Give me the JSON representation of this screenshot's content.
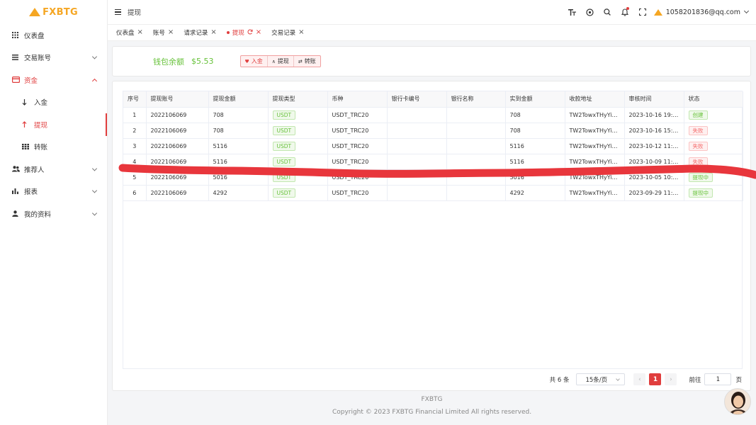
{
  "brand": {
    "logo_text": "FXBTG",
    "accent": "#e03d3d",
    "logo_color": "#f5a623"
  },
  "sidebar": {
    "items": [
      {
        "label": "仪表盘",
        "icon": "grid-icon"
      },
      {
        "label": "交易账号",
        "icon": "list-icon",
        "expandable": true
      },
      {
        "label": "资金",
        "icon": "card-icon",
        "expandable": true,
        "open": true,
        "children": [
          {
            "label": "入金",
            "icon": "arrow-down-icon"
          },
          {
            "label": "提现",
            "icon": "arrow-up-icon",
            "active": true
          },
          {
            "label": "转账",
            "icon": "transfer-grid-icon"
          }
        ]
      },
      {
        "label": "推荐人",
        "icon": "users-icon",
        "expandable": true
      },
      {
        "label": "报表",
        "icon": "bar-chart-icon",
        "expandable": true
      },
      {
        "label": "我的资料",
        "icon": "user-icon",
        "expandable": true
      }
    ]
  },
  "header": {
    "breadcrumb": "提现",
    "user_email": "1058201836@qq.com"
  },
  "tabs": [
    {
      "label": "仪表盘"
    },
    {
      "label": "账号"
    },
    {
      "label": "请求记录"
    },
    {
      "label": "提现",
      "active": true
    },
    {
      "label": "交易记录"
    }
  ],
  "wallet": {
    "label": "钱包余额",
    "amount": "$5.53",
    "buttons": {
      "deposit": "入金",
      "withdraw": "提现",
      "transfer": "转账"
    }
  },
  "table": {
    "columns": [
      "序号",
      "提现账号",
      "提现金额",
      "提现类型",
      "币种",
      "银行卡编号",
      "银行名称",
      "实到金额",
      "收款地址",
      "审核时间",
      "状态"
    ],
    "rows": [
      {
        "no": "1",
        "account": "2022106069",
        "amount": "708",
        "type": "USDT",
        "currency": "USDT_TRC20",
        "card": "",
        "bank": "",
        "received": "708",
        "address": "TW2TowxTHyYis...",
        "time": "2023-10-16 19:0...",
        "status": "创建",
        "status_color": "green"
      },
      {
        "no": "2",
        "account": "2022106069",
        "amount": "708",
        "type": "USDT",
        "currency": "USDT_TRC20",
        "card": "",
        "bank": "",
        "received": "708",
        "address": "TW2TowxTHyYis...",
        "time": "2023-10-16 15:0...",
        "status": "失败",
        "status_color": "red"
      },
      {
        "no": "3",
        "account": "2022106069",
        "amount": "5116",
        "type": "USDT",
        "currency": "USDT_TRC20",
        "card": "",
        "bank": "",
        "received": "5116",
        "address": "TW2TowxTHyYis...",
        "time": "2023-10-12 11:4...",
        "status": "失败",
        "status_color": "red"
      },
      {
        "no": "4",
        "account": "2022106069",
        "amount": "5116",
        "type": "USDT",
        "currency": "USDT_TRC20",
        "card": "",
        "bank": "",
        "received": "5116",
        "address": "TW2TowxTHyYis...",
        "time": "2023-10-09 11:0...",
        "status": "失败",
        "status_color": "red"
      },
      {
        "no": "5",
        "account": "2022106069",
        "amount": "5016",
        "type": "USDT",
        "currency": "USDT_TRC20",
        "card": "",
        "bank": "",
        "received": "5016",
        "address": "TW2TowxTHyYis...",
        "time": "2023-10-05 10:0...",
        "status": "提现中",
        "status_color": "green"
      },
      {
        "no": "6",
        "account": "2022106069",
        "amount": "4292",
        "type": "USDT",
        "currency": "USDT_TRC20",
        "card": "",
        "bank": "",
        "received": "4292",
        "address": "TW2TowxTHyYis...",
        "time": "2023-09-29 11:1...",
        "status": "提现中",
        "status_color": "green"
      }
    ]
  },
  "pagination": {
    "total": "共 6 条",
    "page_size": "15条/页",
    "current_page": "1",
    "goto_label": "前往",
    "goto_value": "1",
    "page_unit": "页"
  },
  "footer": {
    "brand": "FXBTG",
    "copyright": "Copyright © 2023 FXBTG Financial Limited All rights reserved."
  }
}
